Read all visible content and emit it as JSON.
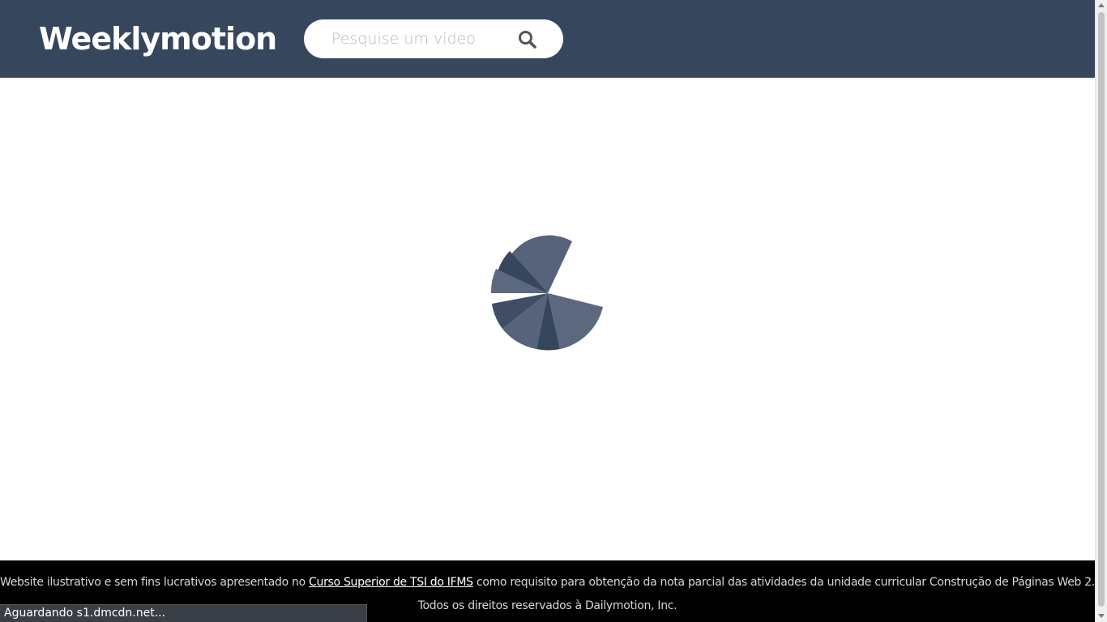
{
  "header": {
    "logo_text": "Weeklymotion",
    "background_color": "#36465d",
    "search": {
      "placeholder": "Pesquise um vídeo",
      "value": "",
      "icon": "search-icon"
    }
  },
  "main": {
    "loading_indicator": "pie-spinner",
    "spinner_color": "#36465d"
  },
  "footer": {
    "line1_before": "Website ilustrativo e sem fins lucrativos apresentado no ",
    "line1_link": "Curso Superior de TSI do IFMS",
    "line1_after": " como requisito para obtenção da nota parcial das atividades da unidade curricular Construção de Páginas Web 2.",
    "line2": "Todos os direitos reservados à Dailymotion, Inc."
  },
  "browser_status": {
    "text": "Aguardando s1.dmcdn.net..."
  }
}
